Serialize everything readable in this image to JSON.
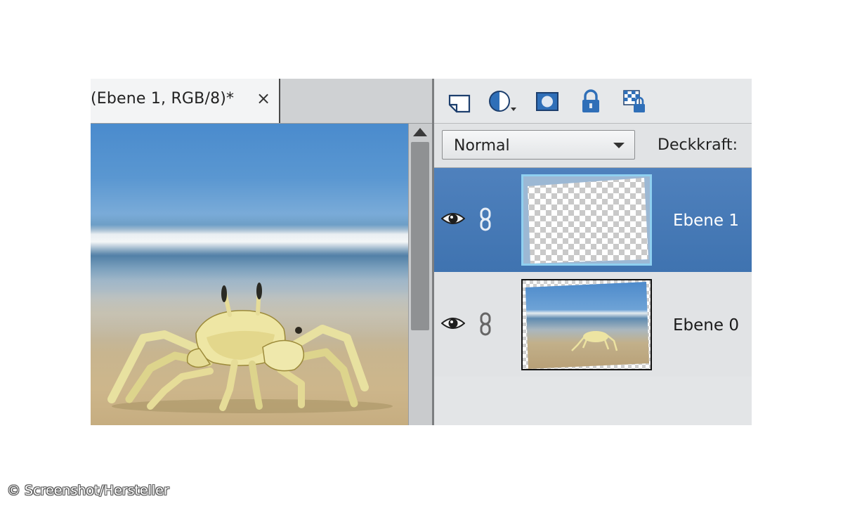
{
  "document": {
    "tab_title": "(Ebene 1, RGB/8)*",
    "close_glyph": "×"
  },
  "layers_panel": {
    "toolbar_icons": [
      "new-layer-icon",
      "adjustment-layer-icon",
      "layer-mask-icon",
      "lock-all-icon",
      "lock-transparency-icon"
    ],
    "blend_mode": "Normal",
    "opacity_label": "Deckkraft:",
    "layers": [
      {
        "name": "Ebene 1",
        "selected": true,
        "thumbnail": "transparent-checkerboard"
      },
      {
        "name": "Ebene 0",
        "selected": false,
        "thumbnail": "crab-on-beach"
      }
    ]
  },
  "credit": "© Screenshot/Hersteller",
  "colors": {
    "selection": "#4f81bd",
    "panel": "#e3e5e7",
    "sky": "#4a8bcd",
    "sand": "#c8b58f",
    "icon_blue": "#2f6fb8"
  }
}
